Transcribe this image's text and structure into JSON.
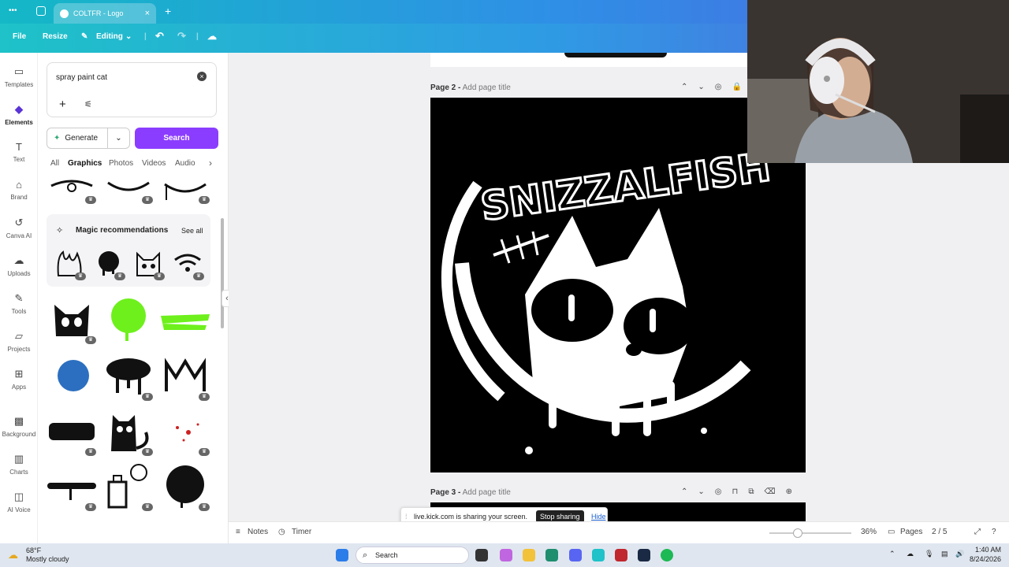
{
  "browser": {
    "tab_title": "COLTFR - Logo",
    "new_tab": "+",
    "menu_dots": "•••"
  },
  "toolbar": {
    "file": "File",
    "resize": "Resize",
    "editing": "Editing"
  },
  "rail": {
    "items": [
      {
        "label": "Templates",
        "icon": "templates-icon"
      },
      {
        "label": "Elements",
        "icon": "elements-icon"
      },
      {
        "label": "Text",
        "icon": "text-icon"
      },
      {
        "label": "Brand",
        "icon": "brand-icon"
      },
      {
        "label": "Canva AI",
        "icon": "canva-ai-icon"
      },
      {
        "label": "Uploads",
        "icon": "uploads-icon"
      },
      {
        "label": "Tools",
        "icon": "tools-icon"
      },
      {
        "label": "Projects",
        "icon": "projects-icon"
      },
      {
        "label": "Apps",
        "icon": "apps-icon"
      },
      {
        "label": "Background",
        "icon": "background-icon"
      },
      {
        "label": "Charts",
        "icon": "charts-icon"
      },
      {
        "label": "AI Voice",
        "icon": "ai-voice-icon"
      }
    ]
  },
  "panel": {
    "search_value": "spray paint cat",
    "generate": "Generate",
    "search": "Search",
    "filters": [
      "All",
      "Graphics",
      "Photos",
      "Videos",
      "Audio"
    ],
    "active_filter": "Graphics",
    "magic_title": "Magic recommendations",
    "see_all": "See all"
  },
  "canvas": {
    "page2_label": "Page 2 -",
    "page2_title_placeholder": "Add page title",
    "page3_label": "Page 3 -",
    "page3_title_placeholder": "Add page title",
    "design_text": "SNIZZALFISH"
  },
  "bottombar": {
    "notes": "Notes",
    "timer": "Timer",
    "zoom": "36%",
    "pages": "Pages",
    "page_count": "2 / 5"
  },
  "share_bar": {
    "message": "live.kick.com is sharing your screen.",
    "stop": "Stop sharing",
    "hide": "Hide"
  },
  "taskbar": {
    "weather_temp": "68°F",
    "weather_desc": "Mostly cloudy",
    "search": "Search",
    "time": "1:40 AM",
    "date": "8/24/2026"
  },
  "colors": {
    "accent": "#8b3dff",
    "brand_gradient_start": "#14b8c6",
    "brand_gradient_end": "#4f66e0"
  }
}
